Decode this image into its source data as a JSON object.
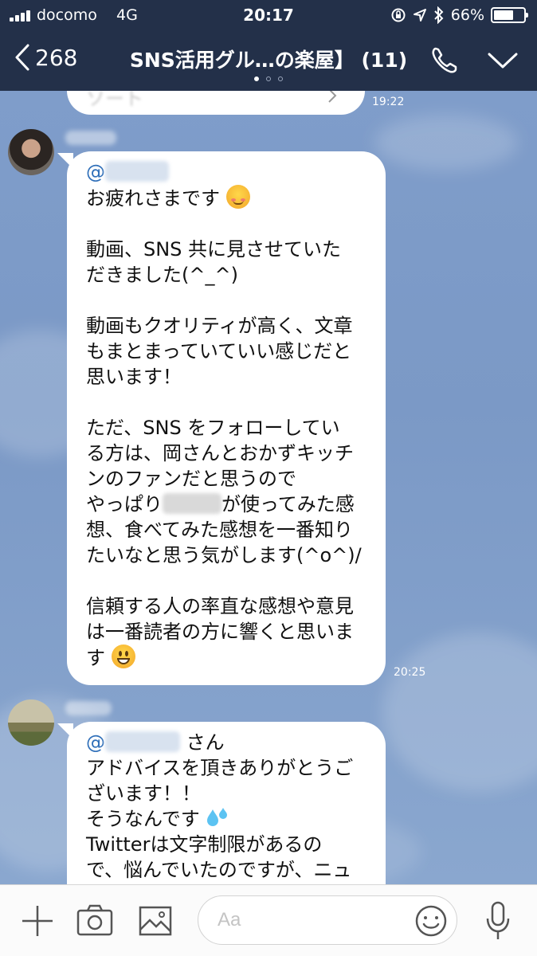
{
  "status_bar": {
    "carrier": "docomo",
    "network": "4G",
    "time": "20:17",
    "battery": "66%",
    "battery_level": 0.66
  },
  "header": {
    "back_count": "268",
    "title": "SNS活用グル…の楽屋】 (11)",
    "page_dots": 3,
    "active_dot": 0
  },
  "messages": [
    {
      "timestamp": "19:22",
      "lines": [
        "ソート"
      ]
    },
    {
      "timestamp": "20:25",
      "mention": "@",
      "lines": [
        "お疲れさまです",
        "",
        "動画、SNS 共に見させていた",
        "だきました(^_^)",
        "",
        "動画もクオリティが高く、文章",
        "もまとまっていていい感じだと",
        "思います！",
        "",
        "ただ、SNS をフォローしてい",
        "る方は、岡さんとおかずキッチ",
        "ンのファンだと思うので",
        "やっぱり",
        "が使ってみた感",
        "想、食べてみた感想を一番知り",
        "たいなと思う気がします(^o^)/",
        "",
        "信頼する人の率直な感想や意見",
        "は一番読者の方に響くと思いま",
        "す"
      ]
    },
    {
      "mention": "@",
      "mention_suffix": "さん",
      "lines": [
        "アドバイスを頂きありがとうご",
        "ざいます！！",
        "そうなんです",
        "Twitterは文字制限があるの",
        "で、悩んでいたのですが、ニュ"
      ]
    }
  ],
  "input_bar": {
    "placeholder": "Aa",
    "icons": [
      "plus-icon",
      "camera-icon",
      "image-icon",
      "emoji-icon",
      "microphone-icon"
    ]
  },
  "colors": {
    "header_bg": "#233049",
    "chat_bg": "#7d9bc8",
    "mention": "#2f6fb9",
    "bubble": "#ffffff"
  }
}
